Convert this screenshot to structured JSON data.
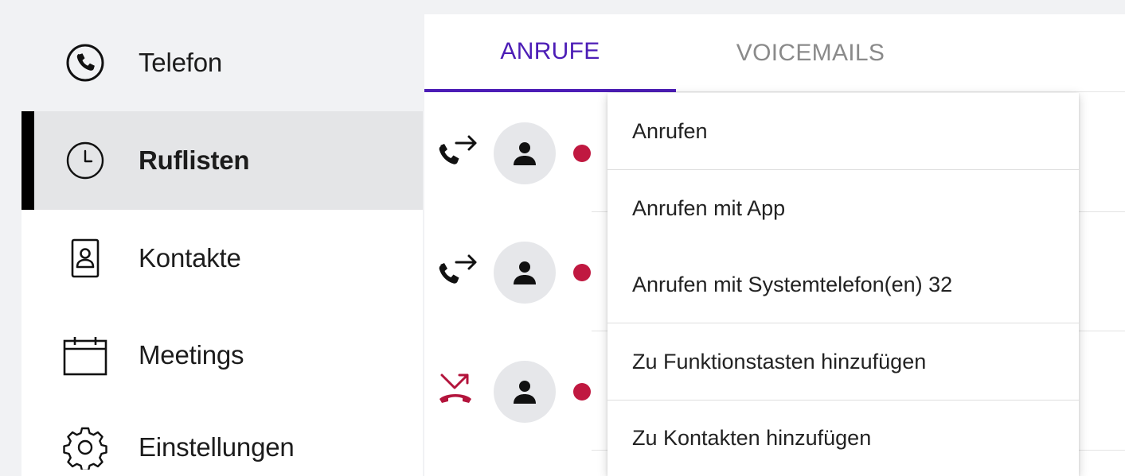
{
  "sidebar": {
    "items": [
      {
        "label": "Telefon",
        "icon": "phone-icon"
      },
      {
        "label": "Ruflisten",
        "icon": "clock-icon",
        "active": true
      },
      {
        "label": "Kontakte",
        "icon": "contact-card-icon"
      },
      {
        "label": "Meetings",
        "icon": "calendar-icon"
      },
      {
        "label": "Einstellungen",
        "icon": "gear-icon"
      }
    ]
  },
  "tabs": [
    {
      "label": "ANRUFE",
      "active": true
    },
    {
      "label": "VOICEMAILS",
      "active": false
    }
  ],
  "calls": [
    {
      "direction": "outgoing",
      "icon": "outgoing-call-icon",
      "status": "busy"
    },
    {
      "direction": "outgoing",
      "icon": "outgoing-call-icon",
      "status": "busy"
    },
    {
      "direction": "missed",
      "icon": "missed-call-icon",
      "status": "busy"
    }
  ],
  "context_menu": {
    "items": [
      {
        "label": "Anrufen"
      },
      {
        "label": "Anrufen mit App"
      },
      {
        "label": "Anrufen mit Systemtelefon(en) 32"
      },
      {
        "label": "Zu Funktionstasten hinzufügen"
      },
      {
        "label": "Zu Kontakten hinzufügen"
      }
    ]
  },
  "colors": {
    "accent": "#4c1db6",
    "status_red": "#c01840",
    "missed_red": "#b3143c",
    "sidebar_active_bg": "#e4e5e7",
    "inactive_tab": "#8a8a8a"
  }
}
